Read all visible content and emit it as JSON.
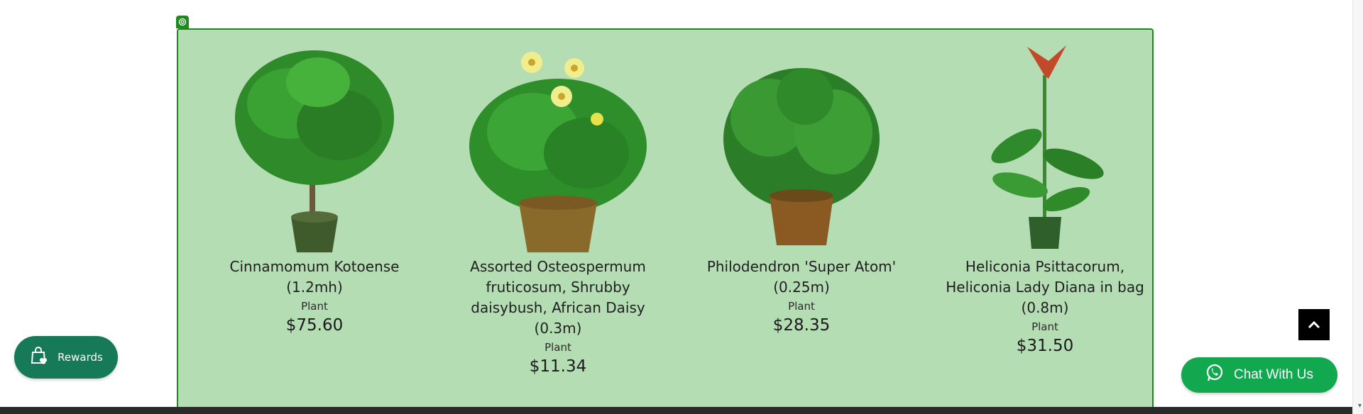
{
  "products": [
    {
      "name": "Cinnamomum Kotoense (1.2mh)",
      "type": "Plant",
      "price": "$75.60"
    },
    {
      "name": "Assorted Osteospermum fruticosum, Shrubby daisybush, African Daisy (0.3m)",
      "type": "Plant",
      "price": "$11.34"
    },
    {
      "name": "Philodendron 'Super Atom' (0.25m)",
      "type": "Plant",
      "price": "$28.35"
    },
    {
      "name": "Heliconia Psittacorum, Heliconia Lady Diana in bag (0.8m)",
      "type": "Plant",
      "price": "$31.50"
    }
  ],
  "rewards": {
    "label": "Rewards",
    "icon": "shopping-bag-heart-icon"
  },
  "chat": {
    "label": "Chat With Us",
    "icon": "whatsapp-icon"
  },
  "back_to_top": {
    "icon": "chevron-up-icon"
  },
  "colors": {
    "overlay": "#b4ddb4",
    "overlay_border": "#1e8a1e",
    "rewards_bg": "#167a58",
    "chat_bg": "#12a84f"
  }
}
